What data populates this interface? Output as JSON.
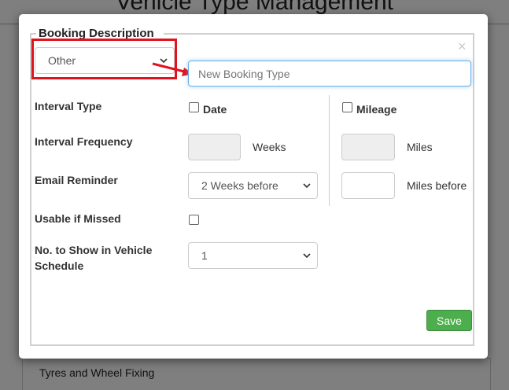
{
  "background": {
    "page_title": "Vehicle Type Management",
    "row_text": "Tyres and Wheel Fixing"
  },
  "modal": {
    "legend": "Booking Description",
    "close_glyph": "×",
    "booking_select_value": "Other",
    "new_type_placeholder": "New Booking Type",
    "interval_type_label": "Interval Type",
    "date_label": "Date",
    "mileage_label": "Mileage",
    "interval_frequency_label": "Interval Frequency",
    "weeks_unit": "Weeks",
    "miles_unit": "Miles",
    "email_reminder_label": "Email Reminder",
    "email_reminder_value": "2 Weeks before",
    "miles_before_unit": "Miles before",
    "usable_if_missed_label": "Usable if Missed",
    "no_to_show_label_line1": "No. to Show in Vehicle",
    "no_to_show_label_line2": "Schedule",
    "no_to_show_value": "1",
    "save_label": "Save"
  },
  "colors": {
    "highlight": "#e0141e",
    "save_button": "#4cae4c",
    "input_focus": "#66afe9"
  },
  "icons": {
    "close": "close-icon",
    "dropdown": "chevron-down-icon",
    "annotation": "red-arrow-annotation"
  }
}
